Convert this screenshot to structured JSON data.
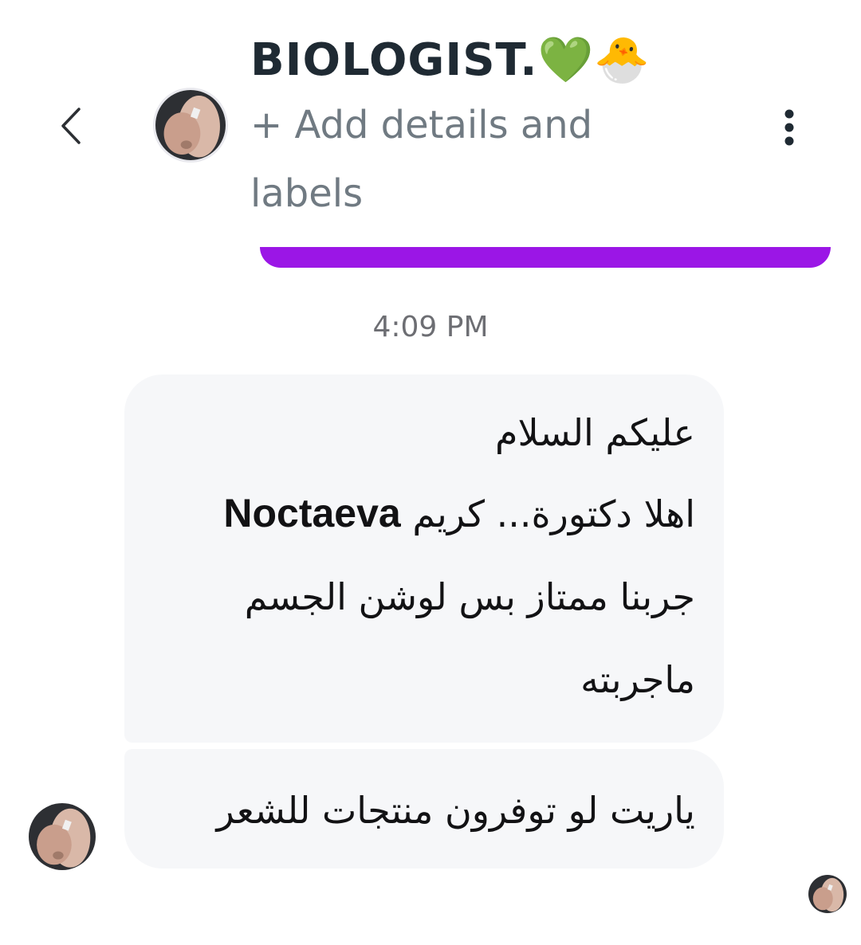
{
  "header": {
    "title": "BIOLOGIST.💚🐣",
    "details_link": "+ Add details and labels",
    "back_icon": "chevron-left-icon",
    "more_icon": "more-vertical-icon"
  },
  "colors": {
    "accent": "#9b16e6",
    "bubble_bg": "#f6f7f9",
    "timestamp": "#6d6e73"
  },
  "conversation": {
    "timestamp": "4:09 PM",
    "messages": [
      {
        "lines": [
          "عليكم السلام",
          {
            "pre": "اهلا دكتورة... كريم ",
            "brand": "Noctaeva"
          },
          "جربنا ممتاز  بس لوشن الجسم",
          "ماجربته"
        ]
      },
      {
        "lines": [
          "ياريت لو توفرون منتجات للشعر"
        ]
      }
    ]
  }
}
